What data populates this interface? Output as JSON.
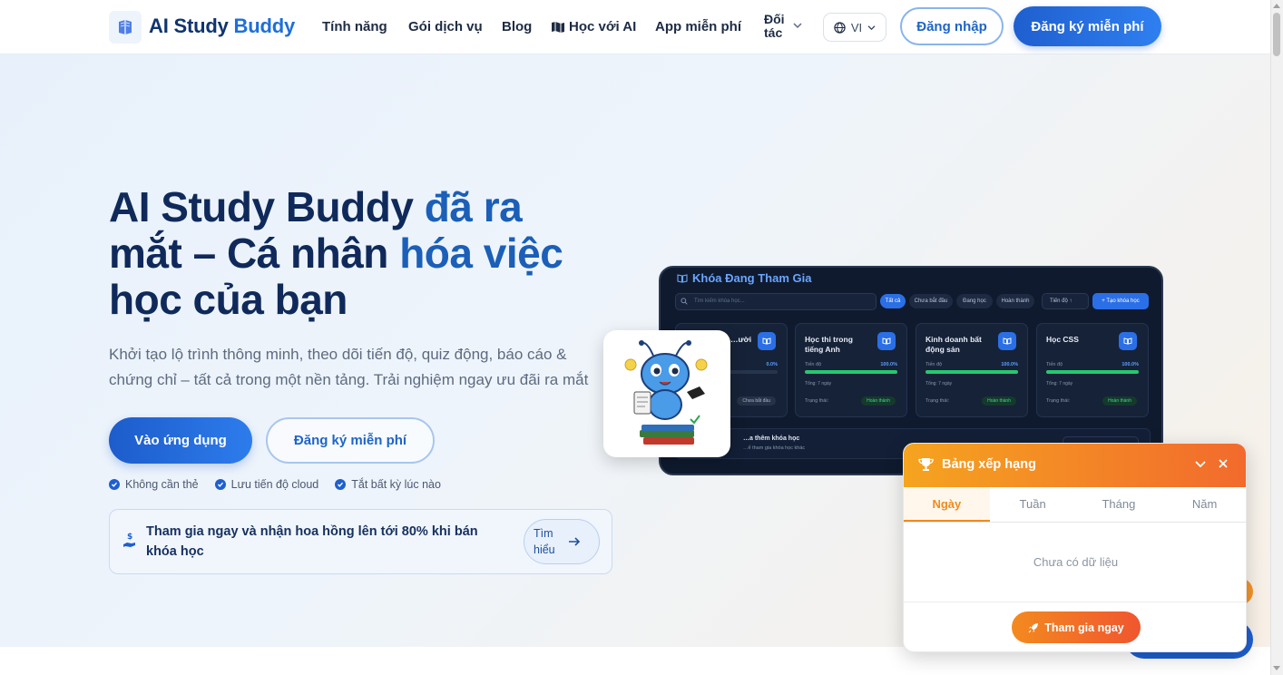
{
  "header": {
    "brand_main": "AI Study ",
    "brand_accent": "Buddy",
    "nav": {
      "features": "Tính năng",
      "plans": "Gói dịch vụ",
      "blog": "Blog",
      "learn_ai": "Học với AI",
      "free_app": "App miễn phí",
      "partner_line1": "Đối",
      "partner_line2": "tác"
    },
    "lang": "VI",
    "login": "Đăng nhập",
    "signup": "Đăng ký miễn phí"
  },
  "hero": {
    "title_part1": "AI Study Buddy ",
    "title_hl1": "đã ra",
    "title_part2": "mắt – Cá nhân ",
    "title_hl2": "hóa việc",
    "title_part3": "học của bạn",
    "subtitle_line1": "Khởi tạo lộ trình thông minh, theo dõi tiến độ, quiz động, báo cáo &",
    "subtitle_line2": "chứng chỉ – tất cả trong một nền tảng. Trải nghiệm ngay ưu đãi ra mắt",
    "btn_app": "Vào ứng dụng",
    "btn_free": "Đăng ký miễn phí",
    "checks": [
      "Không cần thẻ",
      "Lưu tiến độ cloud",
      "Tắt bất kỳ lúc nào"
    ],
    "promo_text": "Tham gia ngay và nhận hoa hồng lên tới 80% khi bán khóa học",
    "promo_btn_line1": "Tìm",
    "promo_btn_line2": "hiểu"
  },
  "mockup": {
    "title": "Khóa Đang Tham Gia",
    "search_placeholder": "Tìm kiếm khóa học...",
    "filters": [
      "Tất cả",
      "Chưa bắt đầu",
      "Đang học",
      "Hoàn thành"
    ],
    "sort": "Tiến độ ↑",
    "new_course": "+ Tạo khóa học",
    "progress_label": "Tiến độ",
    "status_label": "Trạng thái:",
    "courses": [
      {
        "title": "…ười",
        "progress_text": "0.0%",
        "progress": 0,
        "meta": "",
        "status": "Chưa bắt đầu"
      },
      {
        "title": "Học thi trong tiếng Anh",
        "progress_text": "100.0%",
        "progress": 1,
        "meta": "Tổng: 7 ngày",
        "status": "Hoàn thành"
      },
      {
        "title": "Kinh doanh bất động sản",
        "progress_text": "100.0%",
        "progress": 1,
        "meta": "Tổng: 7 ngày",
        "status": "Hoàn thành"
      },
      {
        "title": "Học CSS",
        "progress_text": "100.0%",
        "progress": 1,
        "meta": "Tổng: 7 ngày",
        "status": "Hoàn thành"
      }
    ],
    "add_title": "…a thêm khóa học",
    "add_sub": "…ể tham gia khóa học khác"
  },
  "leaderboard": {
    "title": "Bảng xếp hạng",
    "tabs": [
      "Ngày",
      "Tuần",
      "Tháng",
      "Năm"
    ],
    "active_tab": "Ngày",
    "empty": "Chưa có dữ liệu",
    "join": "Tham gia ngay"
  },
  "colors": {
    "primary": "#1f5fcf",
    "accent_orange": "#f26a2d",
    "success": "#28c76f"
  },
  "icons": {
    "logo": "book-logo-icon",
    "learn_ai": "map-icon",
    "lang": "globe-icon",
    "check": "check-circle-icon",
    "promo": "hand-coin-icon",
    "promo_btn": "arrow-right-icon",
    "trophy": "trophy-icon",
    "rocket": "rocket-icon"
  }
}
